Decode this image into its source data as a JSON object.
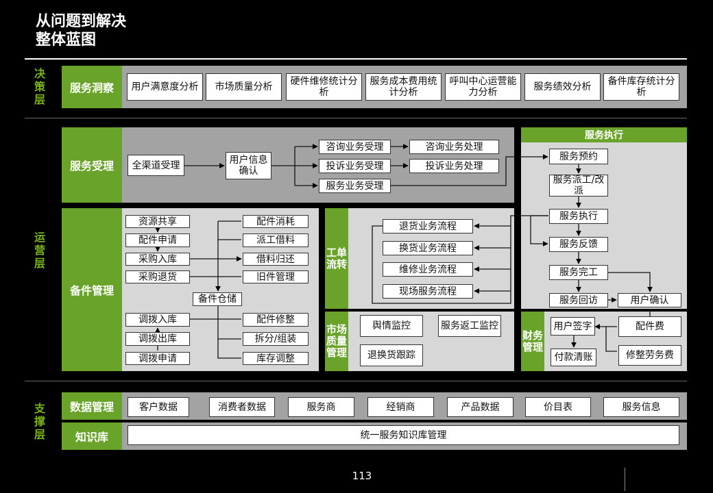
{
  "title": {
    "line1": "从问题到解决",
    "line2": "整体蓝图"
  },
  "layers": {
    "decision": "决策层",
    "operation": "运营层",
    "support": "支撑层"
  },
  "insight": {
    "label": "服务洞察",
    "items": [
      "用户满意度分析",
      "市场质量分析",
      "硬件维修统计分析",
      "服务成本费用统计分析",
      "呼叫中心运营能力分析",
      "服务绩效分析",
      "备件库存统计分析"
    ]
  },
  "acceptance": {
    "label": "服务受理",
    "channel": "全渠道受理",
    "confirm": "用户信息确认",
    "consult_accept": "咨询业务受理",
    "consult_handle": "咨询业务处理",
    "complaint_accept": "投诉业务受理",
    "complaint_handle": "投诉业务处理",
    "service_accept": "服务业务受理"
  },
  "execution": {
    "label": "服务执行",
    "appointment": "服务预约",
    "dispatch": "服务派工/改派",
    "execute": "服务执行",
    "feedback": "服务反馈",
    "complete": "服务完工",
    "revisit": "服务回访",
    "user_confirm": "用户确认"
  },
  "finance": {
    "label": "财务管理",
    "sign": "用户签字",
    "parts_fee": "配件费",
    "payment": "付款清账",
    "repair_fee": "修整劳务费"
  },
  "parts": {
    "label": "备件管理",
    "left_top": [
      "资源共享",
      "配件申请",
      "采购入库",
      "采购退货"
    ],
    "right_top": [
      "配件消耗",
      "派工借料",
      "借料归还",
      "旧件管理"
    ],
    "warehouse": "备件仓储",
    "left_bottom": [
      "调拨入库",
      "调拨出库",
      "调拨申请"
    ],
    "right_bottom": [
      "配件修整",
      "拆分/组装",
      "库存调整"
    ]
  },
  "workorder": {
    "label": "工单流转",
    "items": [
      "退货业务流程",
      "换货业务流程",
      "维修业务流程",
      "现场服务流程"
    ]
  },
  "market": {
    "label": "市场质量管理",
    "items": [
      "舆情监控",
      "服务返工监控",
      "退换货跟踪"
    ]
  },
  "data_mgmt": {
    "label": "数据管理",
    "items": [
      "客户数据",
      "消费者数据",
      "服务商",
      "经销商",
      "产品数据",
      "价目表",
      "服务信息"
    ]
  },
  "knowledge": {
    "label": "知识库",
    "item": "统一服务知识库管理"
  },
  "page_number": "113"
}
